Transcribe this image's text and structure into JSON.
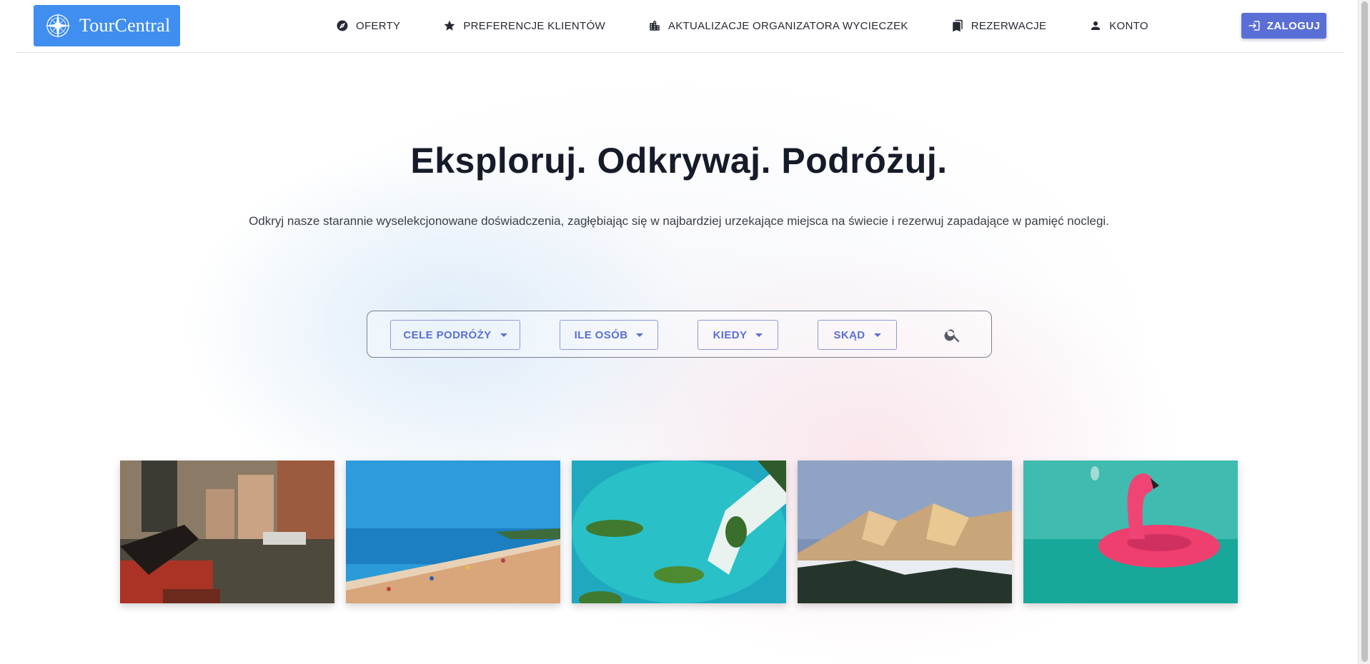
{
  "header": {
    "brand": "TourCentral",
    "nav": [
      {
        "label": "OFERTY",
        "icon": "compass-icon"
      },
      {
        "label": "PREFERENCJE KLIENTÓW",
        "icon": "star-icon"
      },
      {
        "label": "AKTUALIZACJE ORGANIZATORA WYCIECZEK",
        "icon": "building-icon"
      },
      {
        "label": "REZERWACJE",
        "icon": "bookmarks-icon"
      },
      {
        "label": "KONTO",
        "icon": "person-icon"
      }
    ],
    "login_label": "ZALOGUJ"
  },
  "hero": {
    "title": "Eksploruj. Odkrywaj. Podróżuj.",
    "subtitle": "Odkryj nasze starannie wyselekcjonowane doświadczenia, zagłębiając się w najbardziej urzekające miejsca na świecie i rezerwuj zapadające w pamięć noclegi."
  },
  "search": {
    "destinations_label": "CELE PODRÓŻY",
    "guests_label": "ILE OSÓB",
    "when_label": "KIEDY",
    "from_label": "SKĄD"
  },
  "gallery": [
    "venice-gondola",
    "sandy-beach",
    "turquoise-lagoon",
    "snowy-mountains",
    "pink-flamingo-float"
  ],
  "colors": {
    "logo_bg": "#3f8ef0",
    "accent": "#5a6fd6",
    "title": "#161b2a"
  }
}
